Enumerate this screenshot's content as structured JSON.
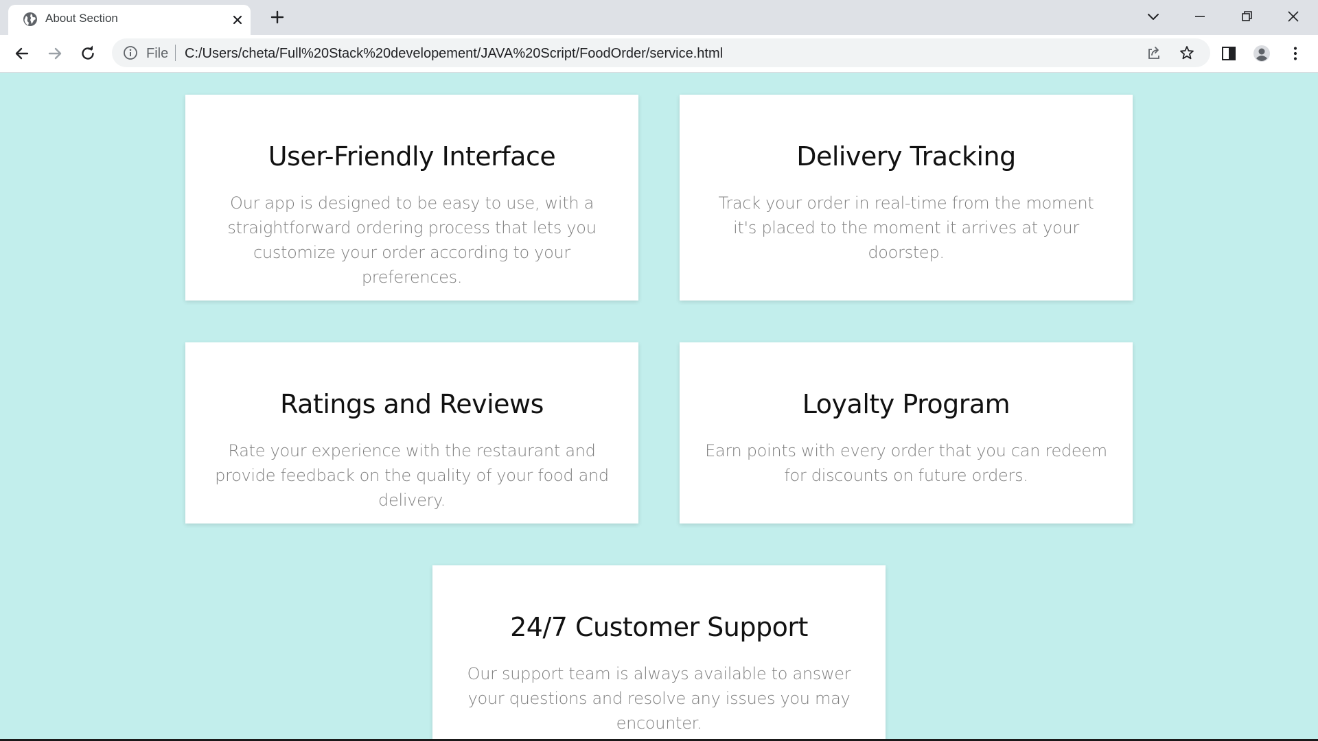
{
  "browser": {
    "tab": {
      "title": "About Section",
      "icon": "globe-icon"
    },
    "address_bar": {
      "scheme_label": "File",
      "url": "C:/Users/cheta/Full%20Stack%20developement/JAVA%20Script/FoodOrder/service.html"
    }
  },
  "services": [
    {
      "title": "User-Friendly Interface",
      "description": "Our app is designed to be easy to use, with a straightforward ordering process that lets you customize your order according to your preferences."
    },
    {
      "title": "Delivery Tracking",
      "description": "Track your order in real-time from the moment it's placed to the moment it arrives at your doorstep."
    },
    {
      "title": "Ratings and Reviews",
      "description": "Rate your experience with the restaurant and provide feedback on the quality of your food and delivery."
    },
    {
      "title": "Loyalty Program",
      "description": "Earn points with every order that you can redeem for discounts on future orders."
    },
    {
      "title": "24/7 Customer Support",
      "description": "Our support team is always available to answer your questions and resolve any issues you may encounter."
    }
  ],
  "colors": {
    "page_background": "#c2eeec",
    "card_background": "#ffffff",
    "heading": "#111111",
    "body_text": "#808080"
  }
}
